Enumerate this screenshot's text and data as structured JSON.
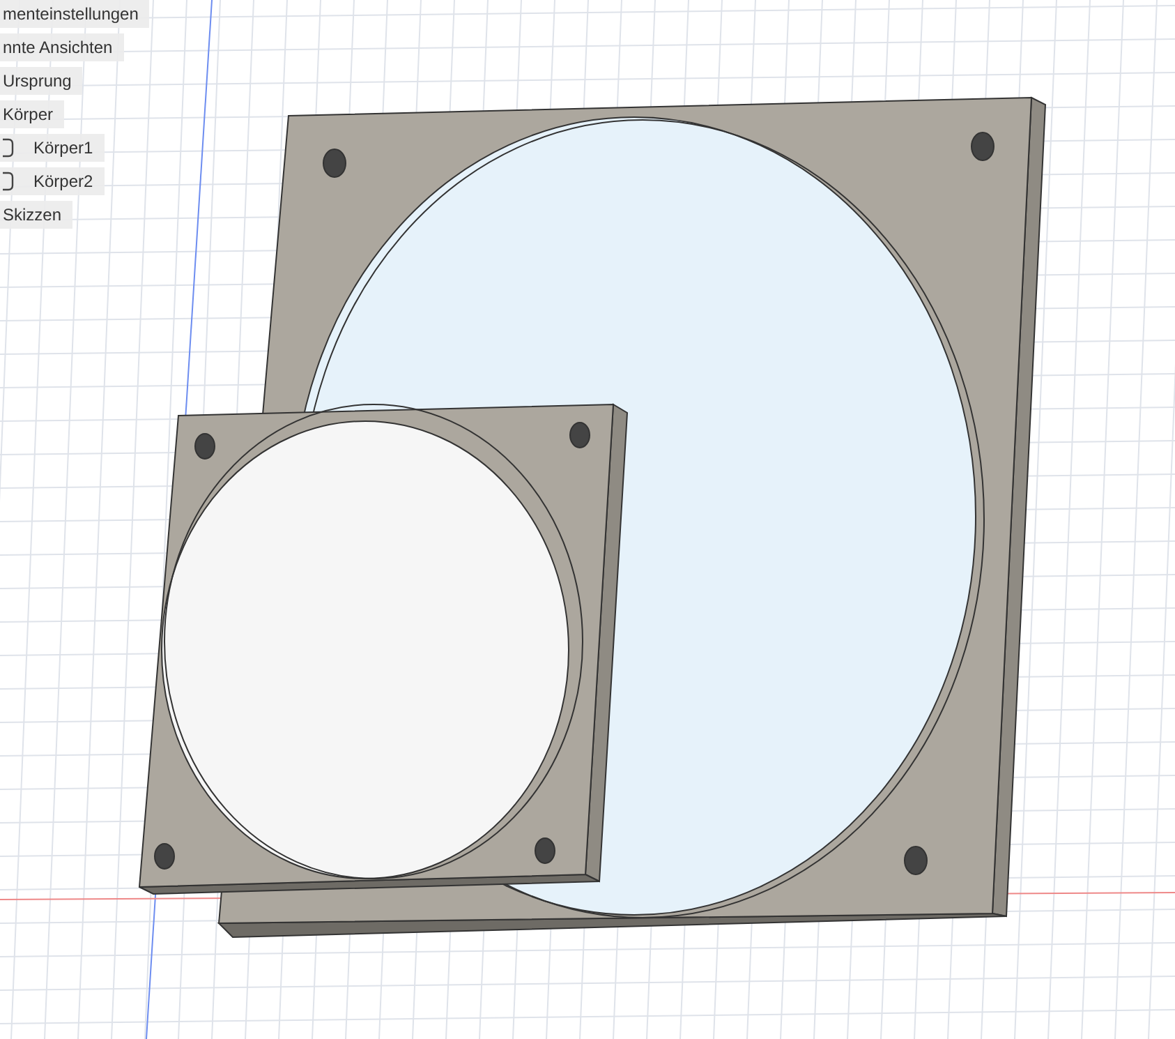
{
  "browser": {
    "items": [
      {
        "label": "menteinstellungen"
      },
      {
        "label": "nnte Ansichten"
      },
      {
        "label": "Ursprung"
      },
      {
        "label": "Körper",
        "children": [
          {
            "label": "Körper1"
          },
          {
            "label": "Körper2"
          }
        ]
      },
      {
        "label": "Skizzen"
      }
    ]
  }
}
